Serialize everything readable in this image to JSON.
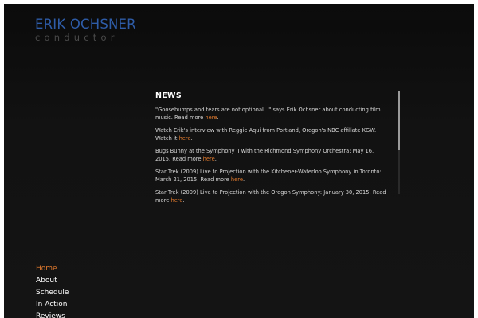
{
  "logo": {
    "name": "ERIK OCHSNER",
    "role": "conductor"
  },
  "colors": {
    "brand_blue": "#2e5ca8",
    "accent_orange": "#e07a2e",
    "background": "#121212"
  },
  "news": {
    "title": "NEWS",
    "items": [
      {
        "text": "\"Goosebumps and tears are not optional...\" says Erik Ochsner about conducting film music. Read more ",
        "link": "here",
        "end": "."
      },
      {
        "text": "Watch Erik's interview with Reggie Aqui from Portland, Oregon's NBC affiliate KGW.  Watch it ",
        "link": "here",
        "end": "."
      },
      {
        "text": "Bugs Bunny at the Symphony II with the Richmond Symphony Orchestra: May 16, 2015.  Read more ",
        "link": "here",
        "end": "."
      },
      {
        "text": "Star Trek (2009) Live to Projection with the Kitchener-Waterloo Symphony in Toronto: March 21, 2015. Read more ",
        "link": "here",
        "end": "."
      },
      {
        "text": "Star Trek (2009) Live to Projection with the Oregon Symphony: January 30, 2015. Read more ",
        "link": "here",
        "end": "."
      }
    ]
  },
  "nav": {
    "items": [
      {
        "label": "Home"
      },
      {
        "label": "About"
      },
      {
        "label": "Schedule"
      },
      {
        "label": "In Action"
      },
      {
        "label": "Reviews"
      }
    ]
  }
}
